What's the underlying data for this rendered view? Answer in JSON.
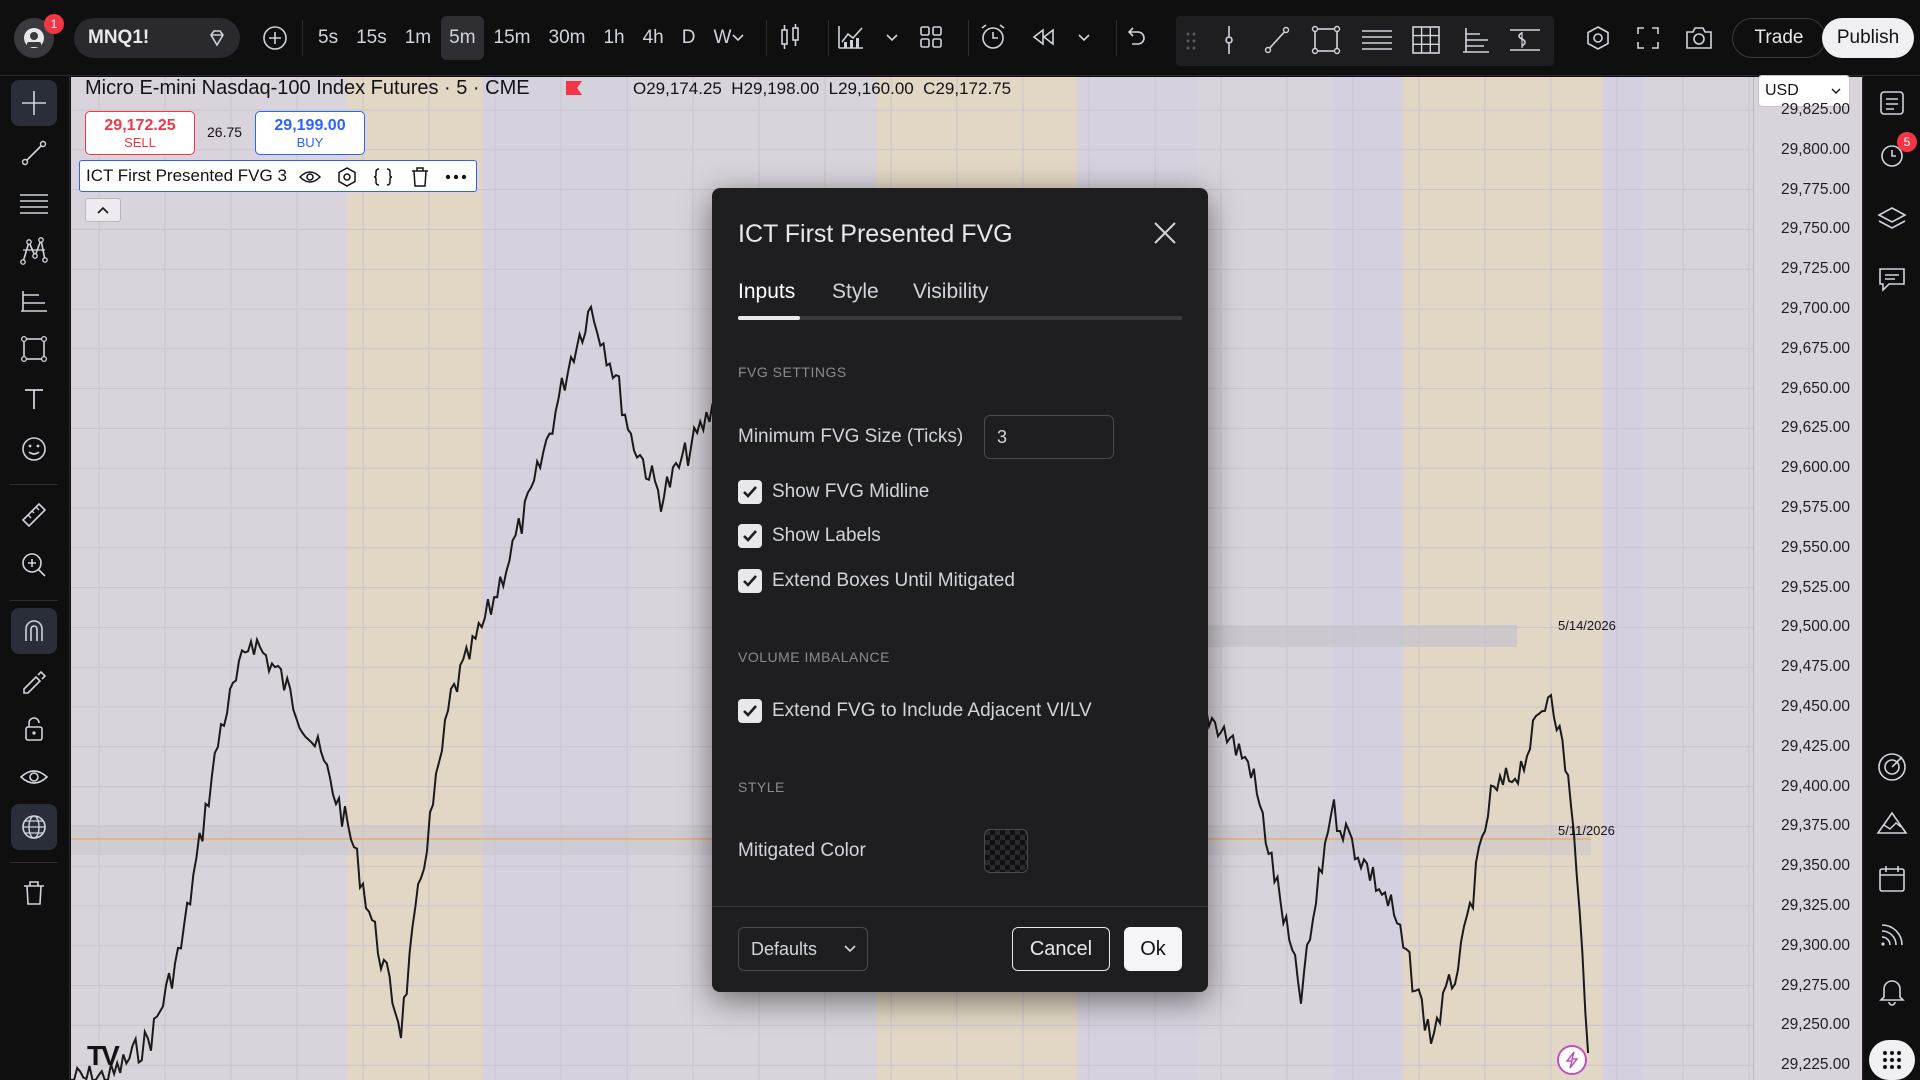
{
  "topbar": {
    "symbol": "MNQ1!",
    "notif_count": "1",
    "intervals": [
      "5s",
      "15s",
      "1m",
      "5m",
      "15m",
      "30m",
      "1h",
      "4h",
      "D",
      "W"
    ],
    "active_interval": "5m",
    "trade_label": "Trade",
    "publish_label": "Publish"
  },
  "chart": {
    "title": "Micro E-mini Nasdaq-100 Index Futures · 5 · CME",
    "ohlc": "O29,174.25  H29,198.00  L29,160.00  C29,172.75",
    "sell_price": "29,172.25",
    "sell_label": "SELL",
    "spread": "26.75",
    "buy_price": "29,199.00",
    "buy_label": "BUY",
    "indicator_label": "ICT First Presented FVG 3",
    "currency": "USD",
    "date_label_1": "5/14/2026",
    "date_label_2": "5/11/2026",
    "price_ticks": [
      "29,825.00",
      "29,800.00",
      "29,775.00",
      "29,750.00",
      "29,725.00",
      "29,700.00",
      "29,675.00",
      "29,650.00",
      "29,625.00",
      "29,600.00",
      "29,575.00",
      "29,550.00",
      "29,525.00",
      "29,500.00",
      "29,475.00",
      "29,450.00",
      "29,425.00",
      "29,400.00",
      "29,375.00",
      "29,350.00",
      "29,325.00",
      "29,300.00",
      "29,275.00",
      "29,250.00",
      "29,225.00"
    ]
  },
  "rightbar": {
    "alert_count": "5"
  },
  "dialog": {
    "title": "ICT First Presented FVG",
    "tabs": [
      {
        "label": "Inputs"
      },
      {
        "label": "Style"
      },
      {
        "label": "Visibility"
      }
    ],
    "fvg_section": "FVG SETTINGS",
    "min_size_label": "Minimum FVG Size (Ticks)",
    "min_size_value": "3",
    "checkboxes": [
      {
        "label": "Show FVG Midline"
      },
      {
        "label": "Show Labels"
      },
      {
        "label": "Extend Boxes Until Mitigated"
      }
    ],
    "vi_section": "VOLUME IMBALANCE",
    "vi_checkbox": "Extend FVG to Include Adjacent VI/LV",
    "style_section": "STYLE",
    "mitigated_label": "Mitigated Color",
    "defaults_label": "Defaults",
    "cancel_label": "Cancel",
    "ok_label": "Ok"
  },
  "colors": {
    "sell": "#f23645",
    "buy": "#2962ff",
    "session_band": "#e9d9b0",
    "candle": "#1a1a1a"
  }
}
